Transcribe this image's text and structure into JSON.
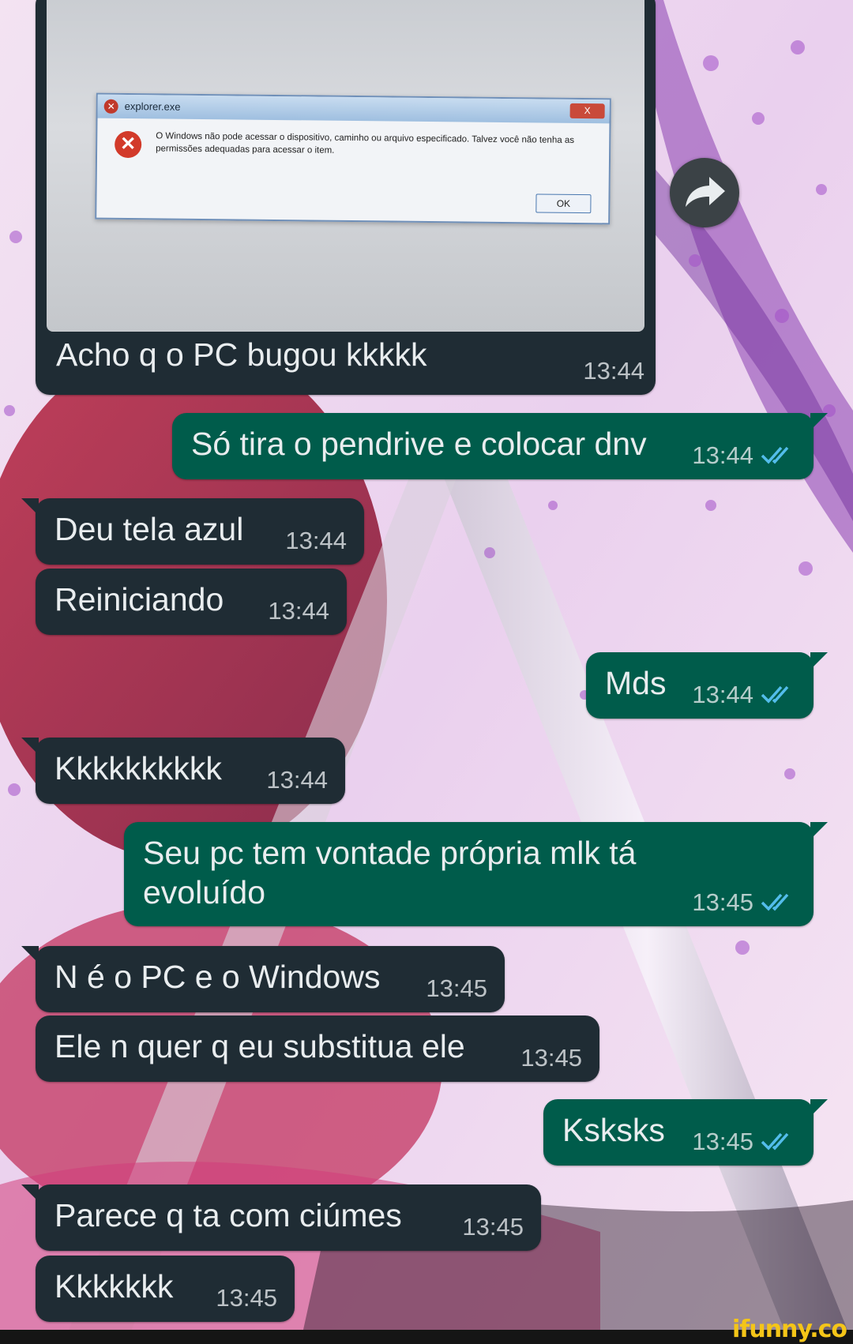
{
  "photo": {
    "dialog_title": "explorer.exe",
    "dialog_message": "O Windows não pode acessar o dispositivo, caminho ou arquivo especificado. Talvez você não tenha as permissões adequadas para acessar o item.",
    "ok_label": "OK",
    "close_label": "X"
  },
  "messages": [
    {
      "direction": "in",
      "text": "Acho q o PC bugou kkkkk",
      "time": "13:44"
    },
    {
      "direction": "out",
      "text": "Só tira o pendrive e colocar dnv",
      "time": "13:44",
      "status": "read"
    },
    {
      "direction": "in",
      "text": "Deu tela azul",
      "time": "13:44"
    },
    {
      "direction": "in",
      "text": "Reiniciando",
      "time": "13:44"
    },
    {
      "direction": "out",
      "text": "Mds",
      "time": "13:44",
      "status": "read"
    },
    {
      "direction": "in",
      "text": "Kkkkkkkkkk",
      "time": "13:44"
    },
    {
      "direction": "out",
      "text": "Seu pc tem vontade própria mlk tá evoluído",
      "time": "13:45",
      "status": "read"
    },
    {
      "direction": "in",
      "text": "N é o PC e o Windows",
      "time": "13:45"
    },
    {
      "direction": "in",
      "text": "Ele n quer q eu substitua ele",
      "time": "13:45"
    },
    {
      "direction": "out",
      "text": "Ksksks",
      "time": "13:45",
      "status": "read"
    },
    {
      "direction": "in",
      "text": "Parece q ta com ciúmes",
      "time": "13:45"
    },
    {
      "direction": "in",
      "text": "Kkkkkkk",
      "time": "13:45"
    }
  ],
  "watermark": "ifunny.co",
  "colors": {
    "incoming_bubble": "#1f2c34",
    "outgoing_bubble": "#005c4b",
    "read_ticks": "#53bdeb",
    "watermark": "#f4c518"
  },
  "icons": {
    "forward": "forward-icon",
    "read_receipt": "double-check-icon",
    "error": "error-icon"
  }
}
